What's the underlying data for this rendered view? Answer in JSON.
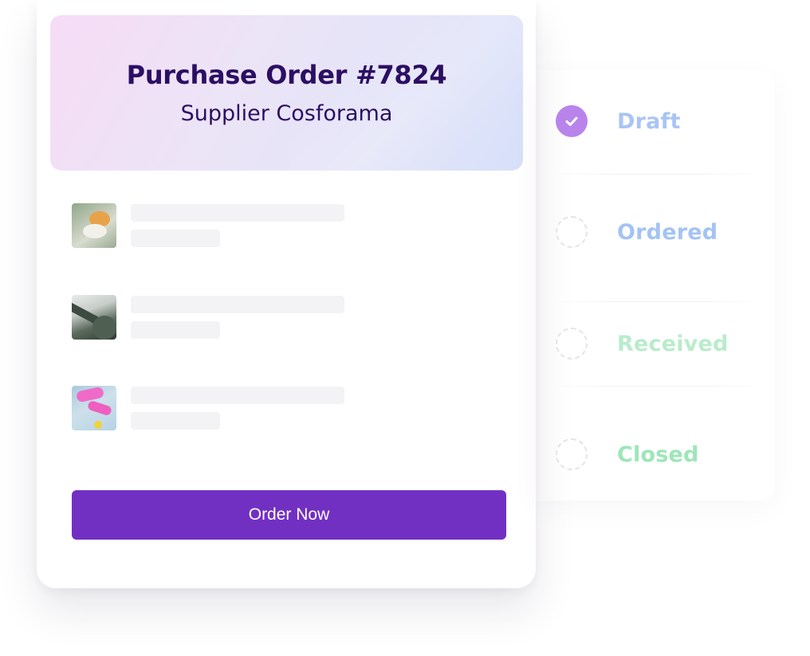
{
  "order": {
    "title": "Purchase Order #7824",
    "supplier": "Supplier Cosforama",
    "items": [
      {
        "image": "product-photo-plant"
      },
      {
        "image": "product-photo-landscape"
      },
      {
        "image": "product-photo-pink-shoes"
      }
    ],
    "order_button_label": "Order Now"
  },
  "statuses": [
    {
      "label": "Draft",
      "completed": true,
      "color": "#a9c4f4"
    },
    {
      "label": "Ordered",
      "completed": false,
      "color": "#a4c3f4"
    },
    {
      "label": "Received",
      "completed": false,
      "color": "#b9eccb"
    },
    {
      "label": "Closed",
      "completed": false,
      "color": "#9de6b8"
    }
  ],
  "colors": {
    "accent": "#7230c2",
    "title_text": "#2c0f63",
    "check_circle": "#b884ec",
    "skeleton": "#f3f3f5"
  }
}
